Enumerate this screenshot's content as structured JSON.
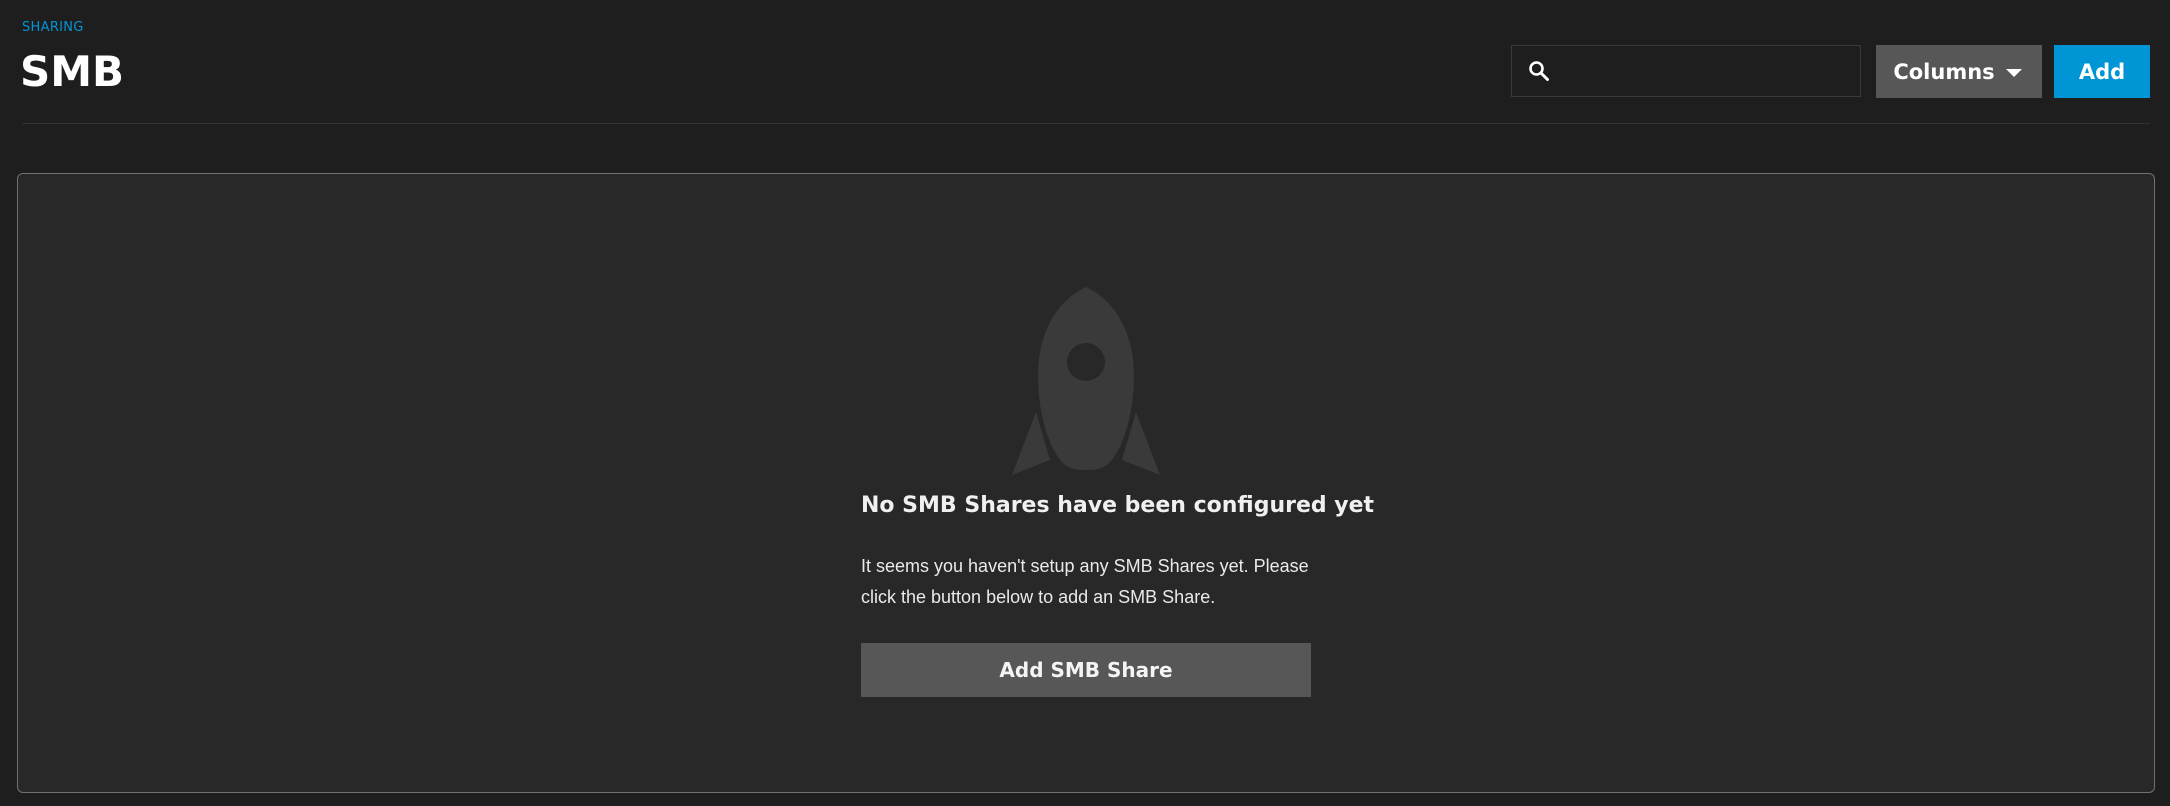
{
  "colors": {
    "accent": "#0095d5",
    "background": "#1e1e1e",
    "card_background": "#282828",
    "button_gray": "#575757",
    "rocket_icon": "#3a3a3a"
  },
  "header": {
    "breadcrumb": "SHARING",
    "title": "SMB"
  },
  "toolbar": {
    "search": {
      "icon": "search-icon",
      "value": "",
      "placeholder": ""
    },
    "columns_label": "Columns",
    "columns_icon": "caret-down-icon",
    "add_label": "Add"
  },
  "empty_state": {
    "icon": "rocket-icon",
    "title": "No SMB Shares have been configured yet",
    "message": "It seems you haven't setup any SMB Shares yet. Please click the button below to add an SMB Share.",
    "button_label": "Add SMB Share"
  }
}
